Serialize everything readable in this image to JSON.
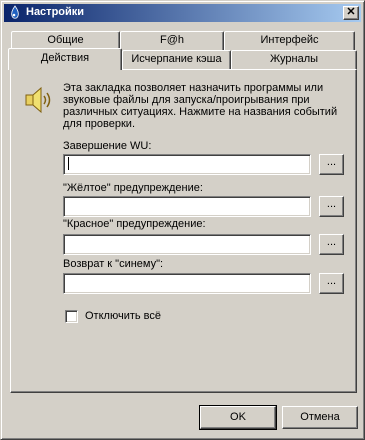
{
  "window": {
    "title": "Настройки",
    "close_symbol": "✕"
  },
  "tabs": {
    "row_top": [
      "Общие",
      "F@h",
      "Интерфейс"
    ],
    "row_bottom": [
      "Действия",
      "Исчерпание кэша",
      "Журналы"
    ],
    "active": "Действия"
  },
  "panel": {
    "description": "Эта закладка позволяет назначить программы или звуковые файлы для запуска/проигрывания при различных ситуациях. Нажмите на названия событий для проверки.",
    "icon": "speaker-icon",
    "fields": [
      {
        "label": "Завершение WU:",
        "value": "",
        "browse_label": "..."
      },
      {
        "label": "\"Жёлтое\" предупреждение:",
        "value": "",
        "browse_label": "..."
      },
      {
        "label": "\"Красное\" предупреждение:",
        "value": "",
        "browse_label": "..."
      },
      {
        "label": "Возврат к \"синему\":",
        "value": "",
        "browse_label": "..."
      }
    ],
    "disable_all": {
      "label": "Отключить всё",
      "checked": false
    }
  },
  "buttons": {
    "ok": "OK",
    "cancel": "Отмена"
  },
  "colors": {
    "face": "#d4d0c8",
    "titlebar_start": "#0a246a",
    "titlebar_end": "#a6caf0"
  }
}
